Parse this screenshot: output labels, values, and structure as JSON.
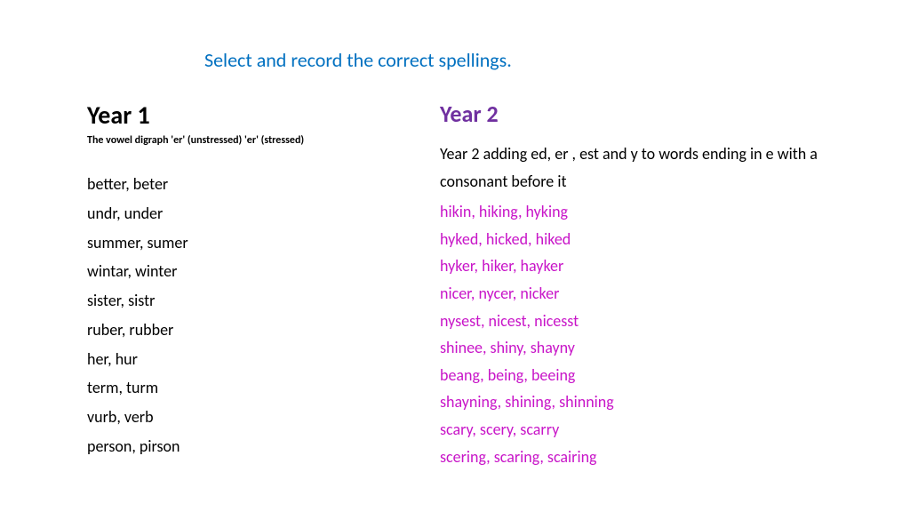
{
  "instruction": "Select and record the correct spellings.",
  "left": {
    "heading": "Year 1",
    "subheading": "The vowel digraph 'er' (unstressed) 'er' (stressed)",
    "items": [
      "better, beter",
      "undr, under",
      "summer, sumer",
      "wintar, winter",
      "sister, sistr",
      "ruber, rubber",
      "her, hur",
      "term, turm",
      "vurb, verb",
      "person, pirson"
    ]
  },
  "right": {
    "heading": "Year 2",
    "subheading": "Year 2 adding ed, er , est and y to words ending in e with a consonant before it",
    "items": [
      "hikin, hiking, hyking",
      "hyked, hicked, hiked",
      "hyker, hiker, hayker",
      "nicer, nycer, nicker",
      "nysest, nicest, nicesst",
      "shinee, shiny, shayny",
      "beang, being, beeing",
      "shayning, shining, shinning",
      "scary, scery, scarry",
      "scering, scaring, scairing"
    ]
  }
}
